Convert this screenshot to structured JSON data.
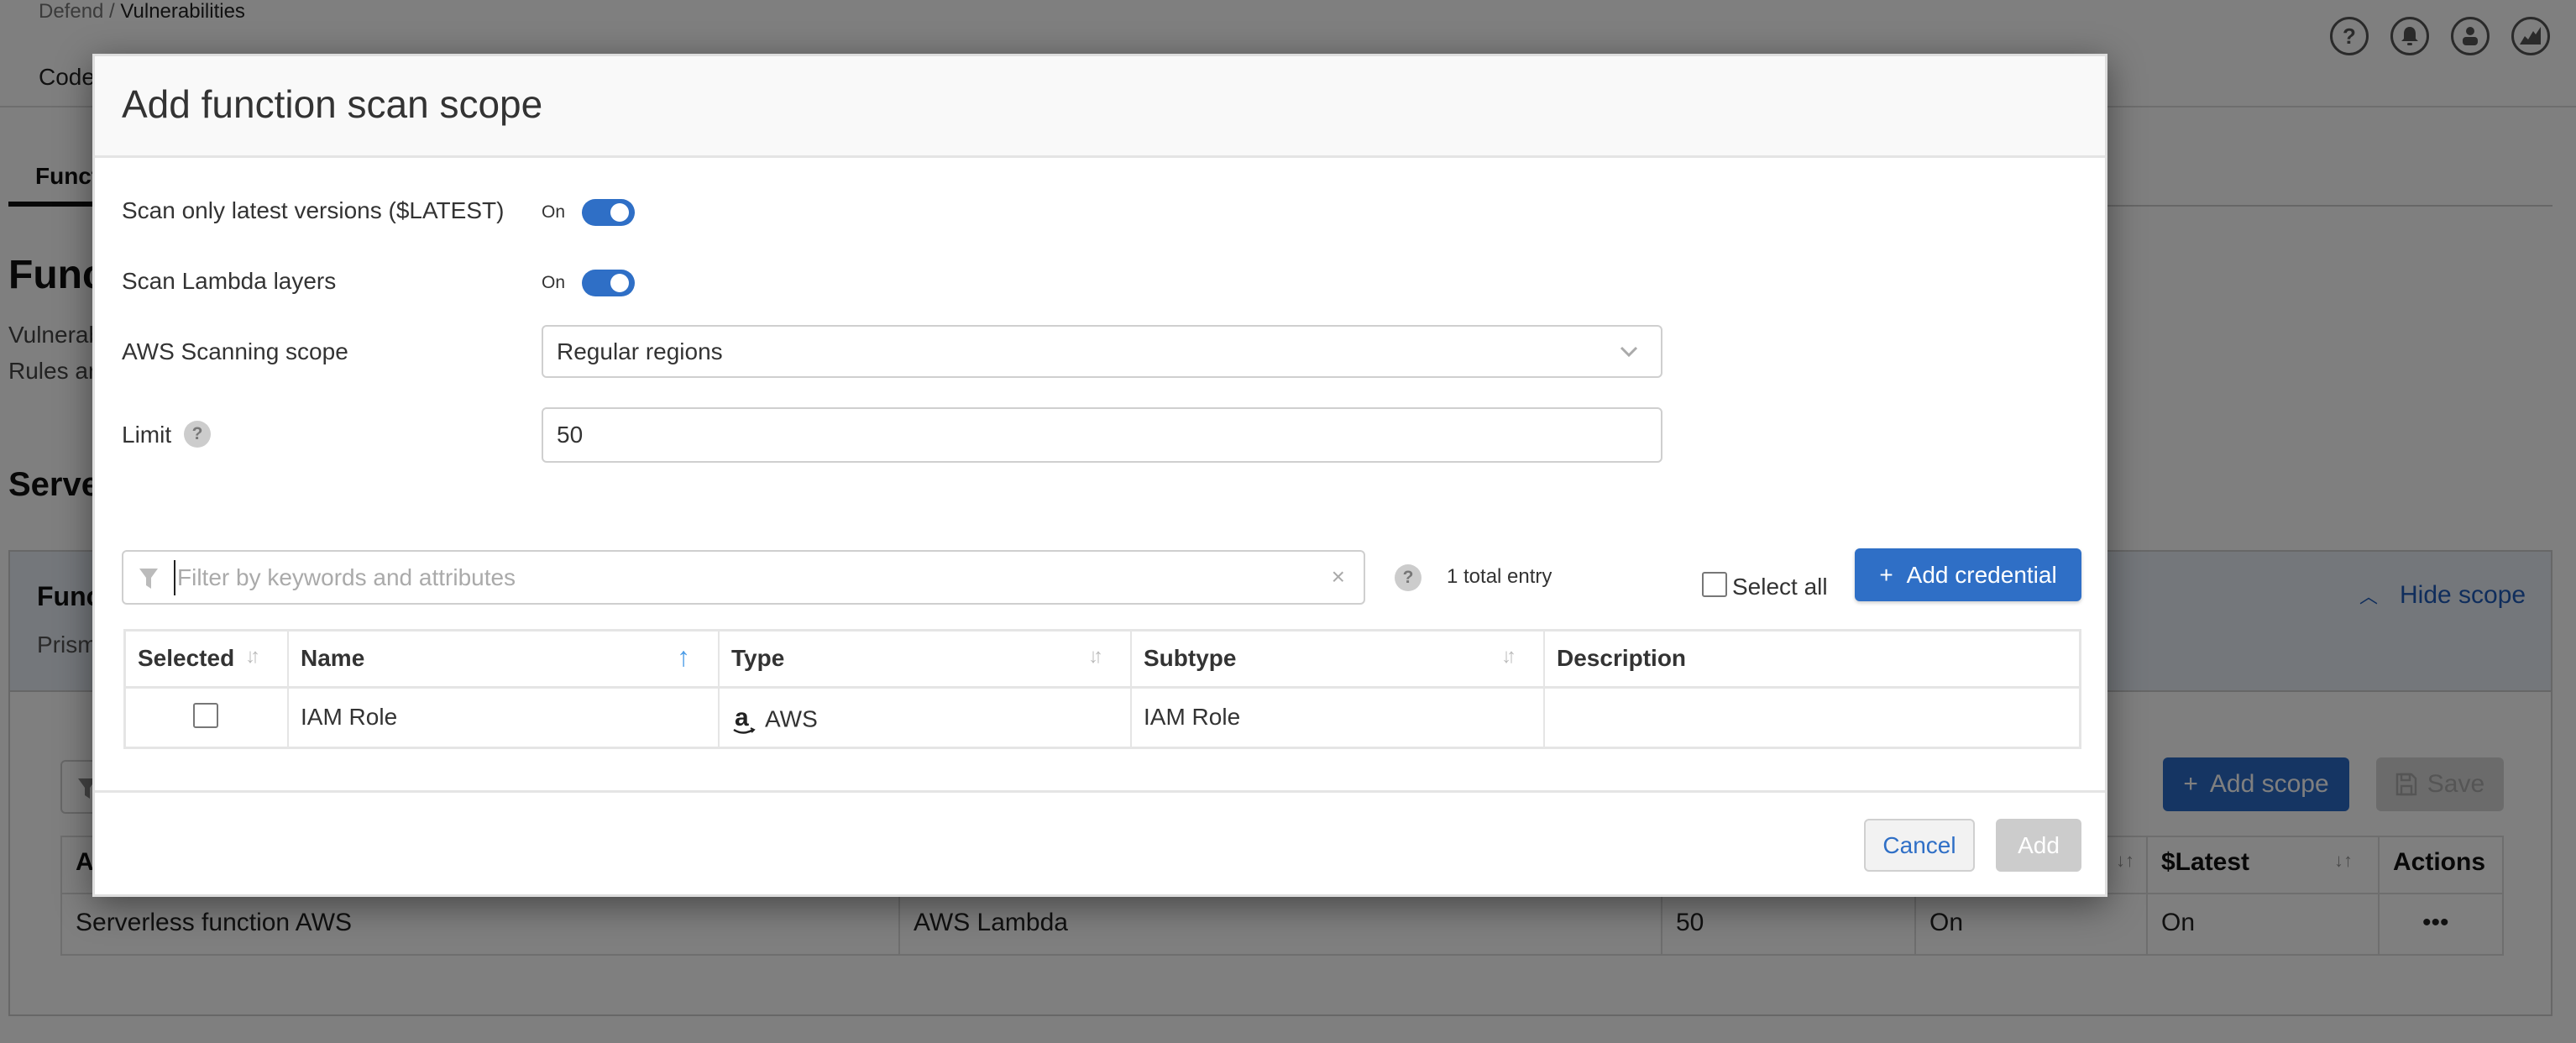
{
  "background": {
    "breadcrumb": {
      "parent": "Defend",
      "separator": " / ",
      "current": "Vulnerabilities"
    },
    "top_nav": {
      "first_item": "Code"
    },
    "header_icons": [
      "help-icon",
      "bell-icon",
      "user-icon",
      "chart-icon"
    ],
    "tab": {
      "label": "Funct"
    },
    "page_title": "Func",
    "page_desc_lines": [
      "Vulnerab",
      "Rules ar"
    ],
    "section_title": "Serve",
    "scope_panel": {
      "title": "Func",
      "subtitle": "Prism",
      "hide_scope_label": "Hide scope"
    },
    "buttons": {
      "add_scope": "Add scope",
      "save": "Save"
    },
    "table": {
      "columns": [
        "A",
        "",
        "",
        "",
        "$Latest",
        "Actions"
      ],
      "rows": [
        {
          "name": "Serverless function AWS",
          "provider": "AWS Lambda",
          "limit": "50",
          "layers": "On",
          "latest": "On",
          "actions": "•••"
        }
      ]
    }
  },
  "modal": {
    "title": "Add function scan scope",
    "fields": {
      "scan_latest": {
        "label": "Scan only latest versions ($LATEST)",
        "state": "On",
        "enabled": true
      },
      "scan_layers": {
        "label": "Scan Lambda layers",
        "state": "On",
        "enabled": true
      },
      "aws_scope": {
        "label": "AWS Scanning scope",
        "selected": "Regular regions"
      },
      "limit": {
        "label": "Limit",
        "value": "50"
      }
    },
    "filter": {
      "placeholder": "Filter by keywords and attributes",
      "value": ""
    },
    "total_entries": "1 total entry",
    "select_all_label": "Select all",
    "add_credential_label": "Add credential",
    "table": {
      "columns": [
        "Selected",
        "Name",
        "Type",
        "Subtype",
        "Description"
      ],
      "sort": {
        "column": "Name",
        "direction": "ascending"
      },
      "rows": [
        {
          "selected": false,
          "name": "IAM Role",
          "type": "AWS",
          "subtype": "IAM Role",
          "description": ""
        }
      ]
    },
    "buttons": {
      "cancel": "Cancel",
      "add": "Add"
    },
    "colors": {
      "accent": "#2f6fc6",
      "disabled": "#cccccc",
      "sort_active": "#4a9be6"
    }
  }
}
